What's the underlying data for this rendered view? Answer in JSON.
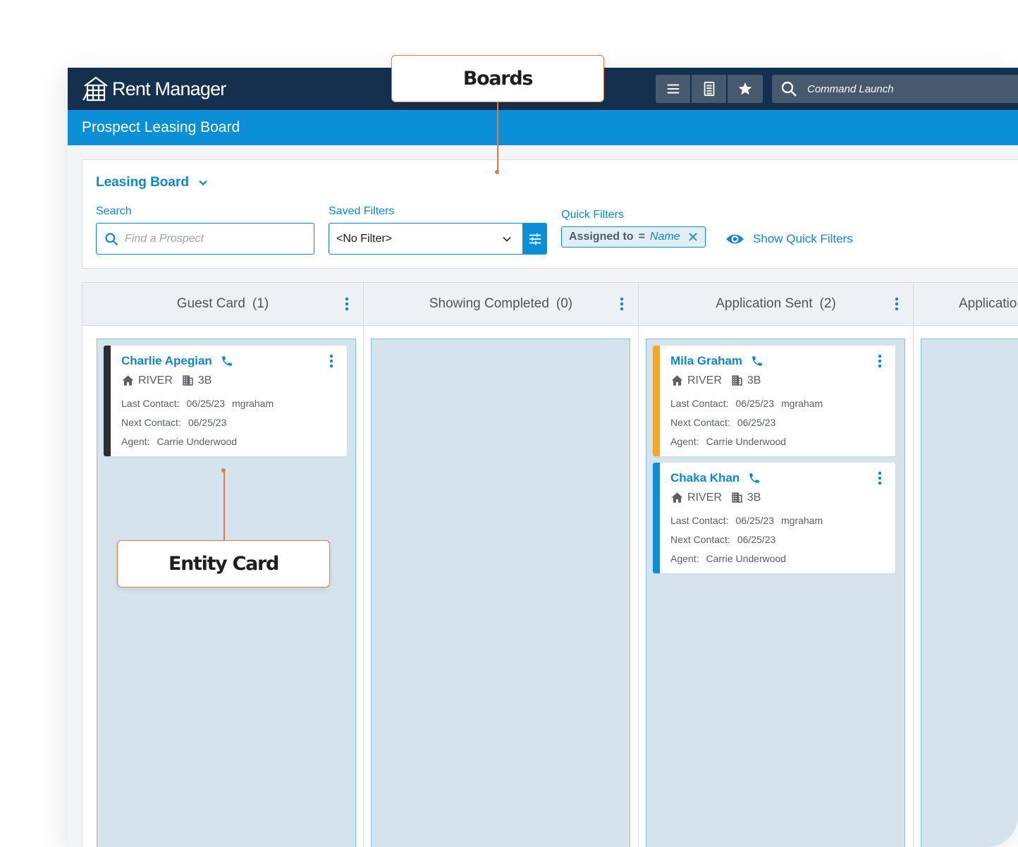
{
  "app": {
    "name": "Rent Manager"
  },
  "nav": {
    "menu_icon": "menu-icon",
    "document_icon": "document-icon",
    "favorite_icon": "star-icon",
    "command_placeholder": "Command Launch"
  },
  "page": {
    "title": "Prospect Leasing Board"
  },
  "filters": {
    "board_name": "Leasing Board",
    "search_label": "Search",
    "search_placeholder": "Find a Prospect",
    "saved_label": "Saved Filters",
    "saved_value": "<No Filter>",
    "quick_label": "Quick Filters",
    "chip": {
      "key": "Assigned to",
      "operator": "=",
      "value": "Name"
    },
    "show_quick": "Show Quick Filters"
  },
  "columns": [
    {
      "title": "Guest Card",
      "count": "(1)"
    },
    {
      "title": "Showing Completed",
      "count": "(0)"
    },
    {
      "title": "Application Sent",
      "count": "(2)"
    },
    {
      "title": "Applicatio",
      "count": ""
    }
  ],
  "card_labels": {
    "last_contact": "Last Contact:",
    "next_contact": "Next Contact:",
    "agent": "Agent:"
  },
  "cards": [
    {
      "name": "Charlie Apegian",
      "property": "RIVER",
      "unit": "3B",
      "last_contact": "06/25/23",
      "last_user": "mgraham",
      "next_contact": "06/25/23",
      "agent": "Carrie Underwood",
      "status_color": "#2b2d31"
    },
    {
      "name": "Mila Graham",
      "property": "RIVER",
      "unit": "3B",
      "last_contact": "06/25/23",
      "last_user": "mgraham",
      "next_contact": "06/25/23",
      "agent": "Carrie Underwood",
      "status_color": "#f5a623"
    },
    {
      "name": "Chaka Khan",
      "property": "RIVER",
      "unit": "3B",
      "last_contact": "06/25/23",
      "last_user": "mgraham",
      "next_contact": "06/25/23",
      "agent": "Carrie Underwood",
      "status_color": "#0b8fd6"
    }
  ],
  "callouts": {
    "boards": "Boards",
    "entity_card": "Entity Card"
  },
  "colors": {
    "nav_bg": "#15304e",
    "brand_blue": "#0b8fd6",
    "link_blue": "#0e87cf",
    "callout_orange": "#e07a4a",
    "lane_bg": "#d5e4ec"
  }
}
